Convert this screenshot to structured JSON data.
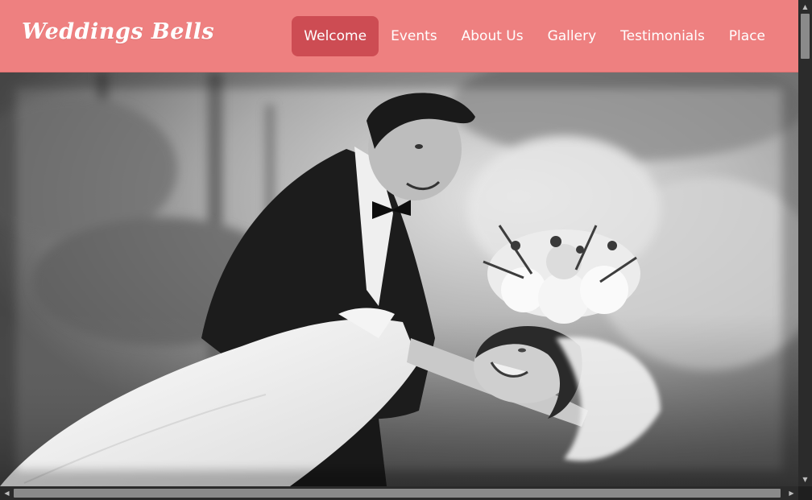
{
  "site": {
    "logo_text": "Weddings Bells"
  },
  "nav": {
    "items": [
      {
        "label": "Welcome",
        "active": true
      },
      {
        "label": "Events",
        "active": false
      },
      {
        "label": "About Us",
        "active": false
      },
      {
        "label": "Gallery",
        "active": false
      },
      {
        "label": "Testimonials",
        "active": false
      },
      {
        "label": "Place",
        "active": false
      }
    ]
  },
  "hero": {
    "image_alt": "Black and white photo of a groom in a tuxedo dipping a laughing bride in a white wedding dress holding a bouquet outdoors"
  },
  "colors": {
    "header_bg": "#ee8080",
    "active_nav_bg": "#cd4c53",
    "nav_text": "#ffffff"
  }
}
